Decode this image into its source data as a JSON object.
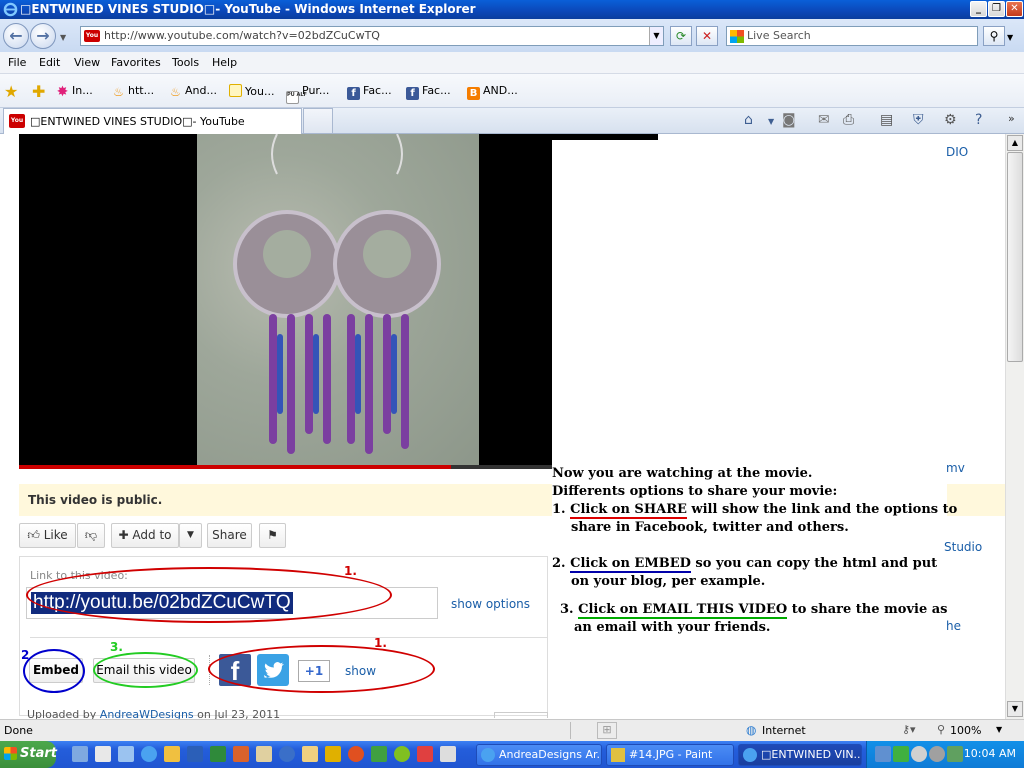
{
  "window": {
    "title": "□ENTWINED VINES STUDIO□- YouTube - Windows Internet Explorer"
  },
  "address": {
    "url": "http://www.youtube.com/watch?v=02bdZCuCwTQ",
    "search_placeholder": "Live Search"
  },
  "menu": {
    "items": [
      "File",
      "Edit",
      "View",
      "Favorites",
      "Tools",
      "Help"
    ]
  },
  "favorites": {
    "items": [
      "In...",
      "htt...",
      "And...",
      "You...",
      "Pur...",
      "Fac...",
      "Fac...",
      "AND..."
    ],
    "pur_badge": "PU ALF"
  },
  "tab": {
    "title": "□ENTWINED VINES STUDIO□- YouTube"
  },
  "youtube": {
    "public_notice": "This video is public.",
    "like_label": "Like",
    "add_to_label": "Add to",
    "share_label": "Share",
    "link_label": "Link to this video:",
    "short_link": "http://youtu.be/02bdZCuCwTQ",
    "show_options": "show options",
    "embed_label": "Embed",
    "email_label": "Email this video",
    "gplus_label": "+1",
    "show_label": "show",
    "uploaded_prefix": "Uploaded by",
    "uploader": "AndreaWDesigns",
    "uploaded_date": "on Jul 23, 2011"
  },
  "instructions": {
    "line1": "Now you are watching at the movie.",
    "line2": "Differents options to share your movie:",
    "item1_num": "1.",
    "item1_link": "Click on SHARE",
    "item1_rest": " will show the link and the options to",
    "item1_cont": "share in Facebook, twitter and others.",
    "item2_num": "2.",
    "item2_link": "Click on EMBED",
    "item2_rest": " so you can copy the html and put",
    "item2_cont": "on your blog,  per example.",
    "item3_num": "3.",
    "item3_link": "Click on EMAIL THIS VIDEO",
    "item3_rest": " to share the movie as",
    "item3_cont": "an email with your friends."
  },
  "sidebar_fragments": [
    "DIO",
    "mv",
    "Studio",
    "he"
  ],
  "annotations": {
    "share_link_num": "1.",
    "share_icons_num": "1.",
    "embed_num": "2",
    "email_num": "3."
  },
  "colors": {
    "annotation_red": "#d00000",
    "annotation_blue": "#0000cc",
    "annotation_green": "#22cc22",
    "youtube_link": "#1a5ea8",
    "public_bg": "#fff8dc"
  },
  "video": {
    "progress_fraction": 0.81
  },
  "status": {
    "left": "Done",
    "zone": "Internet",
    "zoom": "100%"
  },
  "taskbar": {
    "start_label": "Start",
    "tasks": [
      "AndreaDesigns Ar...",
      "#14.JPG - Paint",
      "□ENTWINED VIN..."
    ],
    "clock": "10:04 AM"
  }
}
